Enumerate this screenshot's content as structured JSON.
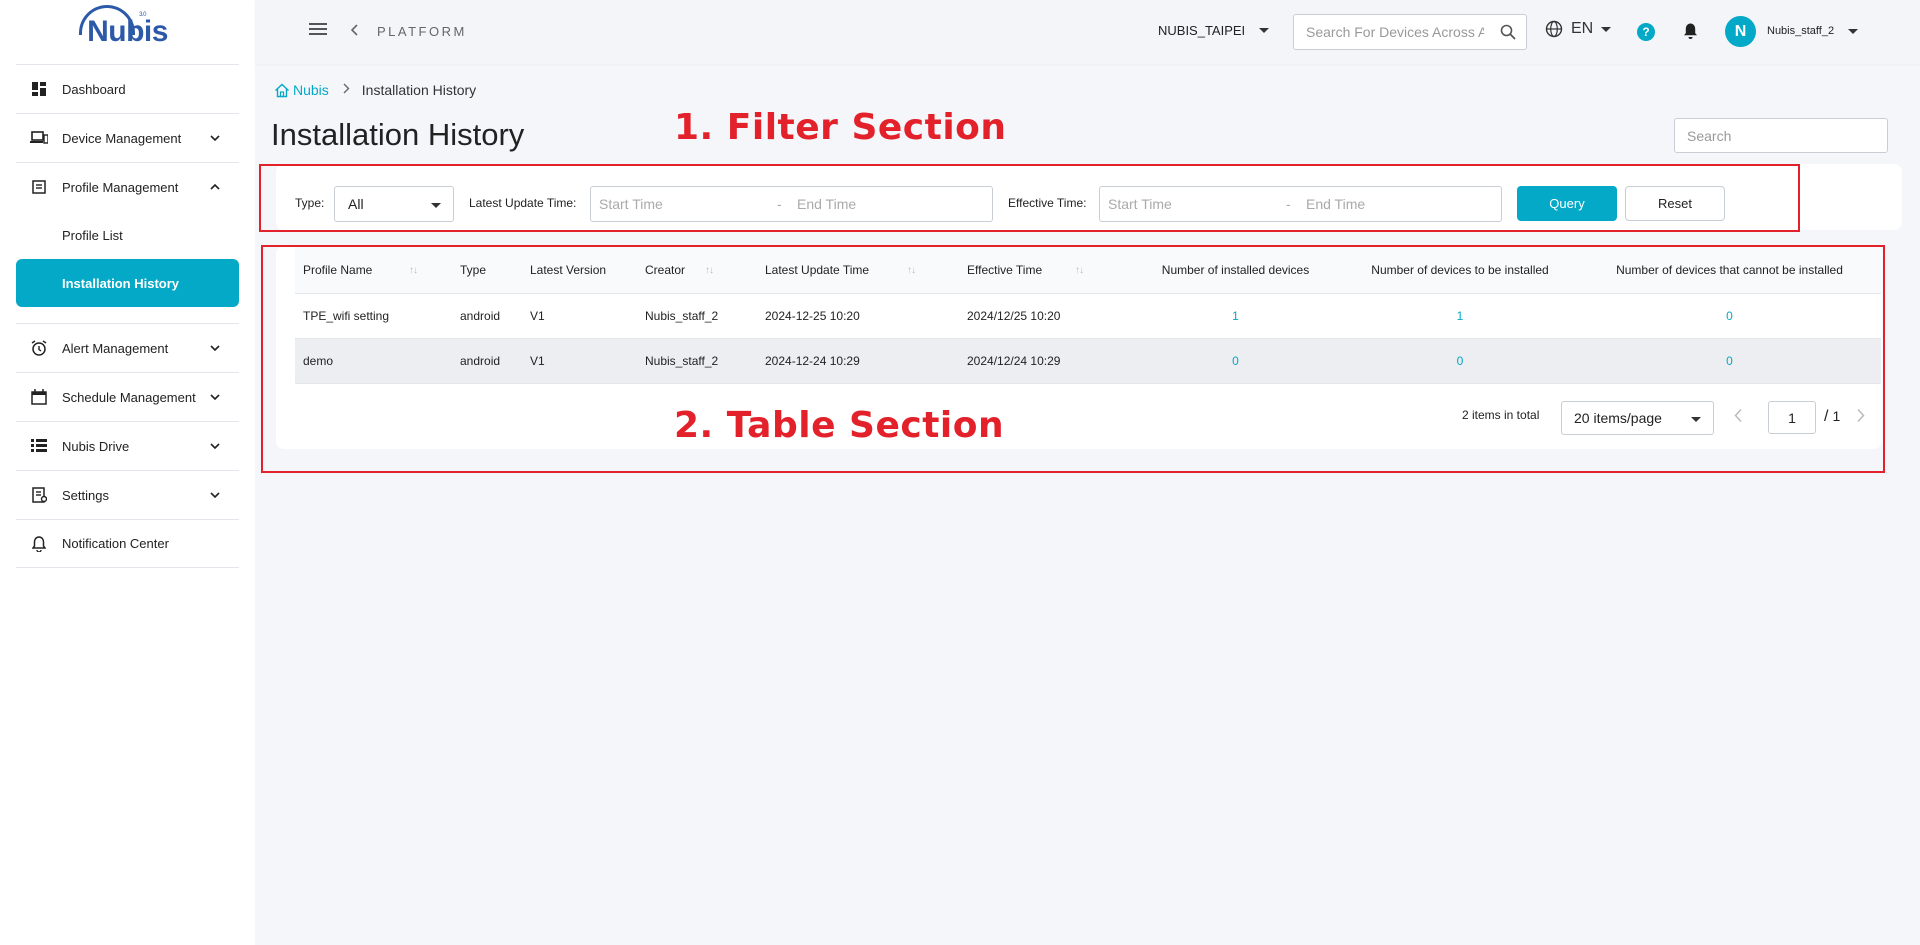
{
  "sidebar": {
    "logo": "Nubis",
    "logo_sup": "3.0",
    "items": [
      {
        "label": "Dashboard",
        "icon": "dashboard-icon"
      },
      {
        "label": "Device Management",
        "icon": "devices-icon"
      },
      {
        "label": "Profile Management",
        "icon": "profile-icon"
      },
      {
        "label": "Alert Management",
        "icon": "alarm-icon"
      },
      {
        "label": "Schedule Management",
        "icon": "calendar-icon"
      },
      {
        "label": "Nubis Drive",
        "icon": "drive-icon"
      },
      {
        "label": "Settings",
        "icon": "settings-icon"
      },
      {
        "label": "Notification Center",
        "icon": "bell-icon"
      }
    ],
    "sub_items": [
      {
        "label": "Profile List"
      },
      {
        "label": "Installation History"
      }
    ]
  },
  "topbar": {
    "platform": "PLATFORM",
    "org": "NUBIS_TAIPEI",
    "search_placeholder": "Search For Devices Across All Groups",
    "lang": "EN",
    "help": "?",
    "avatar": "N",
    "username": "Nubis_staff_2"
  },
  "breadcrumb": {
    "root": "Nubis",
    "current": "Installation History"
  },
  "page": {
    "title": "Installation History",
    "search_placeholder": "Search"
  },
  "annotations": {
    "filter": "1. Filter Section",
    "table": "2. Table Section"
  },
  "filters": {
    "type_label": "Type:",
    "type_value": "All",
    "update_label": "Latest Update Time:",
    "effective_label": "Effective Time:",
    "start_placeholder": "Start Time",
    "end_placeholder": "End Time",
    "dash": "-",
    "query": "Query",
    "reset": "Reset"
  },
  "table": {
    "columns": [
      "Profile Name",
      "Type",
      "Latest Version",
      "Creator",
      "Latest Update Time",
      "Effective Time",
      "Number of installed devices",
      "Number of devices to be installed",
      "Number of devices that cannot be installed"
    ],
    "rows": [
      [
        "TPE_wifi setting",
        "android",
        "V1",
        "Nubis_staff_2",
        "2024-12-25 10:20",
        "2024/12/25 10:20",
        "1",
        "1",
        "0"
      ],
      [
        "demo",
        "android",
        "V1",
        "Nubis_staff_2",
        "2024-12-24 10:29",
        "2024/12/24 10:29",
        "0",
        "0",
        "0"
      ]
    ]
  },
  "pagination": {
    "total": "2 items in total",
    "page_size": "20 items/page",
    "page": "1",
    "slash": "/",
    "pages": "1"
  },
  "colors": {
    "accent": "#03a9c7",
    "annotation": "#e3212b",
    "brand": "#2d5aa8"
  }
}
